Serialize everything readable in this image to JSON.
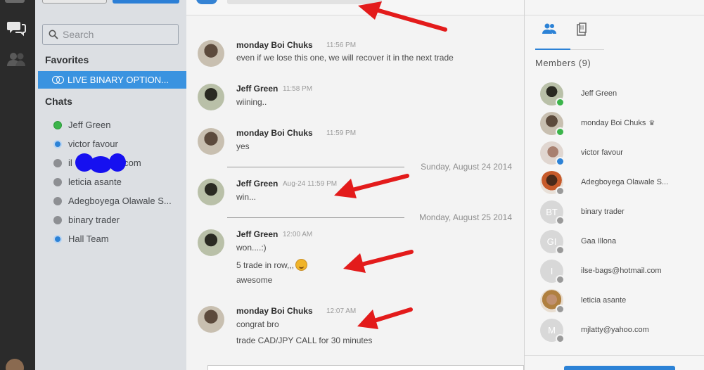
{
  "sidebar": {
    "search_placeholder": "Search",
    "favorites_label": "Favorites",
    "favorite_item": "LIVE BINARY OPTION...",
    "chats_label": "Chats",
    "chats": [
      {
        "name": "Jeff Green",
        "status": "online"
      },
      {
        "name": "victor favour",
        "status": "away"
      },
      {
        "name_prefix": "il",
        "name_suffix": "il.com",
        "status": "offline"
      },
      {
        "name": "leticia asante",
        "status": "offline"
      },
      {
        "name": "Adegboyega Olawale S...",
        "status": "offline"
      },
      {
        "name": "binary trader",
        "status": "offline"
      },
      {
        "name": "Hall Team",
        "status": "away"
      }
    ]
  },
  "chat": {
    "messages": [
      {
        "author": "monday Boi Chuks",
        "time": "11:56 PM",
        "lines": [
          "even if we lose this one, we will recover it in the next trade"
        ]
      },
      {
        "author": "Jeff Green",
        "time": "11:58 PM",
        "lines": [
          "wiining.."
        ]
      },
      {
        "author": "monday Boi Chuks",
        "time": "11:59 PM",
        "lines": [
          "yes"
        ]
      },
      {
        "date_separator": "Sunday, August 24 2014"
      },
      {
        "author": "Jeff Green",
        "time": "Aug-24 11:59 PM",
        "lines": [
          "win..."
        ]
      },
      {
        "date_separator": "Monday, August 25 2014"
      },
      {
        "author": "Jeff Green",
        "time": "12:00 AM",
        "lines": [
          "won....:)",
          "5 trade in row,,,",
          "awesome"
        ]
      },
      {
        "author": "monday Boi Chuks",
        "time": "12:07 AM",
        "lines": [
          "congrat bro",
          "trade CAD/JPY CALL for 30 minutes"
        ]
      }
    ]
  },
  "members_panel": {
    "label": "Members (9)",
    "members": [
      {
        "name": "Jeff Green",
        "status": "online",
        "initials": ""
      },
      {
        "name": "monday Boi Chuks",
        "status": "online",
        "initials": "",
        "crown": "♛"
      },
      {
        "name": "victor favour",
        "status": "away",
        "initials": ""
      },
      {
        "name": "Adegboyega Olawale S...",
        "status": "offline",
        "initials": ""
      },
      {
        "name": "binary trader",
        "status": "offline",
        "initials": "BT"
      },
      {
        "name": "Gaa Illona",
        "status": "offline",
        "initials": "GI"
      },
      {
        "name": "ilse-bags@hotmail.com",
        "status": "offline",
        "initials": "I"
      },
      {
        "name": "leticia asante",
        "status": "offline",
        "initials": ""
      },
      {
        "name": "mjlatty@yahoo.com",
        "status": "offline",
        "initials": "M"
      }
    ]
  },
  "colors": {
    "accent_blue": "#3a93e0",
    "online_green": "#3bb44a",
    "annotation_red": "#e31b1b",
    "scribble_blue": "#1610f0"
  }
}
